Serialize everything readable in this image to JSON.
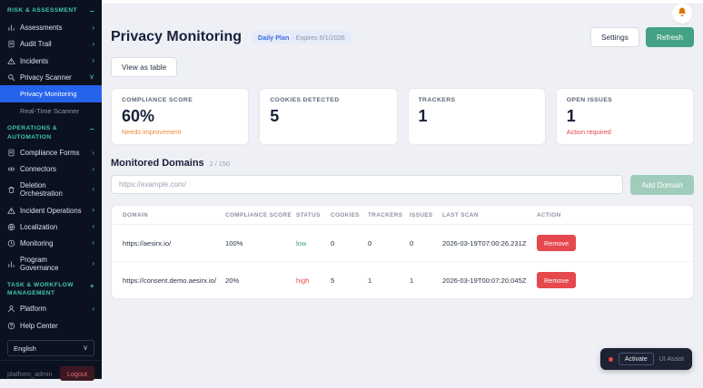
{
  "glyphs": {
    "chevron_right": "›",
    "chevron_down": "∨",
    "minus": "−",
    "plus": "+"
  },
  "colors": {
    "accent_blue": "#2563eb",
    "teal": "#45a184",
    "red": "#e5484d",
    "orange": "#ed8936",
    "sidebar_bg": "#0c1120",
    "section_teal": "#3ec9ae"
  },
  "sidebar": {
    "sections": [
      {
        "title": "RISK & ASSESSMENT",
        "toggle": "−",
        "items": [
          {
            "label": "Assessments"
          },
          {
            "label": "Audit Trail"
          },
          {
            "label": "Incidents"
          },
          {
            "label": "Privacy Scanner"
          }
        ],
        "subitems": [
          {
            "label": "Privacy Monitoring",
            "active": true
          },
          {
            "label": "Real-Time Scanner",
            "active": false
          }
        ]
      },
      {
        "title": "OPERATIONS & AUTOMATION",
        "toggle": "−",
        "items": [
          {
            "label": "Compliance Forms"
          },
          {
            "label": "Connectors"
          },
          {
            "label": "Deletion Orchestration"
          },
          {
            "label": "Incident Operations"
          },
          {
            "label": "Localization"
          },
          {
            "label": "Monitoring"
          },
          {
            "label": "Program Governance"
          }
        ]
      },
      {
        "title": "TASK & WORKFLOW MANAGEMENT",
        "toggle": "+",
        "items": [
          {
            "label": "Platform"
          },
          {
            "label": "Help Center"
          }
        ]
      }
    ],
    "language": "English",
    "username": "platform_admin",
    "logout_label": "Logout"
  },
  "header": {
    "title": "Privacy Monitoring",
    "plan_badge": {
      "plan": "Daily Plan",
      "expires": "· Expires 6/1/2026"
    },
    "settings_label": "Settings",
    "refresh_label": "Refresh",
    "view_toggle_label": "View as table"
  },
  "stats": {
    "cards": [
      {
        "label": "COMPLIANCE SCORE",
        "value": "60%",
        "note": "Needs improvement"
      },
      {
        "label": "COOKIES DETECTED",
        "value": "5",
        "note": ""
      },
      {
        "label": "TRACKERS",
        "value": "1",
        "note": ""
      },
      {
        "label": "OPEN ISSUES",
        "value": "1",
        "note": "Action required"
      }
    ]
  },
  "domains": {
    "heading": "Monitored Domains",
    "count": "2 / 150",
    "input_placeholder": "https://example.com/",
    "input_value": "",
    "add_label": "Add Domain",
    "table": {
      "headers": [
        "DOMAIN",
        "COMPLIANCE SCORE",
        "STATUS",
        "COOKIES",
        "TRACKERS",
        "ISSUES",
        "LAST SCAN",
        "ACTION"
      ],
      "rows": [
        {
          "domain": "https://aesirx.io/",
          "score": "100%",
          "status": "low",
          "cookies": "0",
          "trackers": "0",
          "issues": "0",
          "last_scan": "2026-03-19T07:00:26.231Z",
          "action": "Remove"
        },
        {
          "domain": "https://consent.demo.aesirx.io/",
          "score": "20%",
          "status": "high",
          "cookies": "5",
          "trackers": "1",
          "issues": "1",
          "last_scan": "2026-03-19T00:07:20.045Z",
          "action": "Remove"
        }
      ]
    }
  },
  "assist_widget": {
    "activate_label": "Activate",
    "name_label": "UI Assist"
  }
}
